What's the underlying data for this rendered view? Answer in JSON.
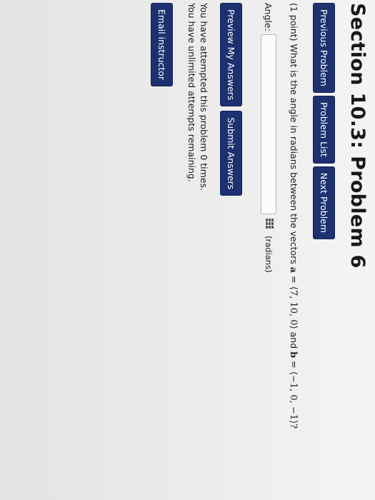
{
  "page": {
    "title": "Section 10.3: Problem 6"
  },
  "nav": {
    "previous_label": "Previous Problem",
    "list_label": "Problem List",
    "next_label": "Next Problem"
  },
  "problem": {
    "points": "(1 point)",
    "question_text": "What is the angle in radians between the vectors",
    "vector_a_name": "a",
    "vector_a_value": "= ⟨7, 10, 0⟩",
    "conjunction": "and",
    "vector_b_name": "b",
    "vector_b_value": "= ⟨−1, 0, −1⟩?"
  },
  "answer": {
    "label": "Angle:",
    "value": "",
    "units": "(radians)"
  },
  "actions": {
    "preview_label": "Preview My Answers",
    "submit_label": "Submit Answers"
  },
  "attempts": {
    "line1": "You have attempted this problem 0 times.",
    "line2": "You have unlimited attempts remaining."
  },
  "email": {
    "label": "Email instructor"
  },
  "colors": {
    "button_bg": "#1d3170",
    "button_text": "#ffffff"
  },
  "icons": {
    "equation_editor": "grid-icon"
  }
}
